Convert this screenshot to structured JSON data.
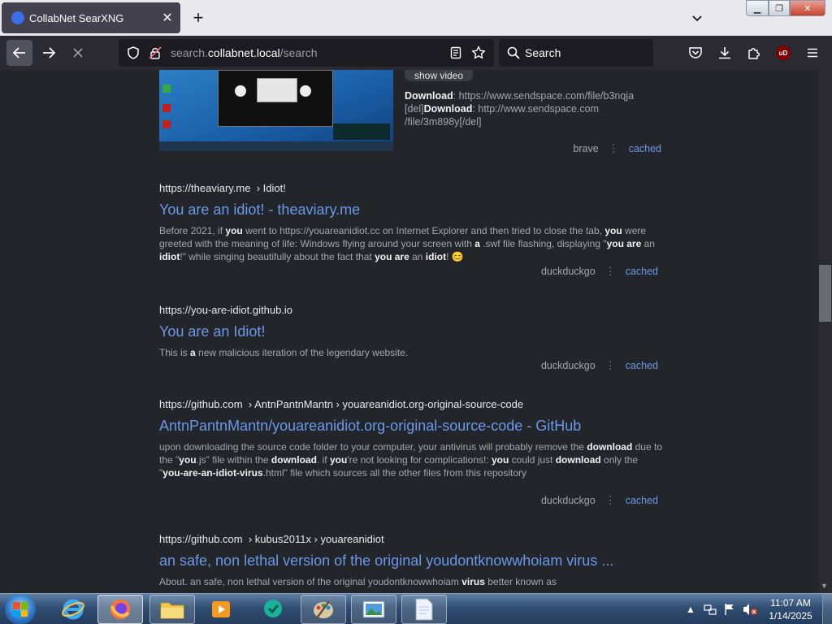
{
  "browser": {
    "tab_title": "CollabNet SearXNG",
    "url_prefix": "search.",
    "url_host": "collabnet.local",
    "url_path": "/search",
    "search_placeholder": "Search",
    "ublock_badge": "uD"
  },
  "top_result": {
    "show_video_label": "show video",
    "download_line1_label": "Download",
    "download_line1_url": ": https://www.sendspace.com/file/b3nqja",
    "download_line2_prefix": "[del]",
    "download_line2_label": "Download",
    "download_line2_url": ": http://www.sendspace.com",
    "download_line3": "/file/3m898y[/del]",
    "engine": "brave",
    "cached": "cached"
  },
  "results": [
    {
      "url_host": "https://theaviary.me",
      "url_crumbs": "› Idiot!",
      "title": "You are an idiot! - theaviary.me",
      "snippet": [
        {
          "t": "Before 2021, if ",
          "b": false
        },
        {
          "t": "you",
          "b": true
        },
        {
          "t": " went to https://youareanidiot.cc on Internet Explorer and then tried to close the tab, ",
          "b": false
        },
        {
          "t": "you",
          "b": true
        },
        {
          "t": " were greeted with the meaning of life: Windows flying around your screen with ",
          "b": false
        },
        {
          "t": "a",
          "b": true
        },
        {
          "t": " .swf file flashing, displaying \"",
          "b": false
        },
        {
          "t": "you are",
          "b": true
        },
        {
          "t": " an ",
          "b": false
        },
        {
          "t": "idiot",
          "b": true
        },
        {
          "t": "!\" while singing beautifully about the fact that ",
          "b": false
        },
        {
          "t": "you are",
          "b": true
        },
        {
          "t": " an ",
          "b": false
        },
        {
          "t": "idiot",
          "b": true
        },
        {
          "t": "! 😊",
          "b": false
        }
      ],
      "engine": "duckduckgo",
      "cached": "cached"
    },
    {
      "url_host": "https://you-are-idiot.github.io",
      "url_crumbs": "",
      "title": "You are an Idiot!",
      "snippet": [
        {
          "t": "This is ",
          "b": false
        },
        {
          "t": "a",
          "b": true
        },
        {
          "t": " new malicious iteration of the legendary website.",
          "b": false
        }
      ],
      "engine": "duckduckgo",
      "cached": "cached"
    },
    {
      "url_host": "https://github.com",
      "url_crumbs": "› AntnPantnMantn › youareanidiot.org-original-source-code",
      "title": "AntnPantnMantn/youareanidiot.org-original-source-code - GitHub",
      "snippet": [
        {
          "t": "upon downloading the source code folder to your computer, your antivirus will probably remove the ",
          "b": false
        },
        {
          "t": "download",
          "b": true
        },
        {
          "t": " due to the \"",
          "b": false
        },
        {
          "t": "you",
          "b": true
        },
        {
          "t": ".js\" file within the ",
          "b": false
        },
        {
          "t": "download",
          "b": true
        },
        {
          "t": ". if ",
          "b": false
        },
        {
          "t": "you",
          "b": true
        },
        {
          "t": "'re not looking for complications!: ",
          "b": false
        },
        {
          "t": "you",
          "b": true
        },
        {
          "t": " could just ",
          "b": false
        },
        {
          "t": "download",
          "b": true
        },
        {
          "t": " only the \"",
          "b": false
        },
        {
          "t": "you-are-an-idiot-virus",
          "b": true
        },
        {
          "t": ".html\" file which sources all the other files from this repository",
          "b": false
        }
      ],
      "engine": "duckduckgo",
      "cached": "cached"
    },
    {
      "url_host": "https://github.com",
      "url_crumbs": "› kubus2011x › youareanidiot",
      "title": "an safe, non lethal version of the original youdontknowwhoiam virus ...",
      "snippet": [
        {
          "t": "About. an safe, non lethal version of the original youdontknowwhoiam ",
          "b": false
        },
        {
          "t": "virus",
          "b": true
        },
        {
          "t": " better known as",
          "b": false
        }
      ],
      "engine": "",
      "cached": ""
    }
  ],
  "taskbar": {
    "time": "11:07 AM",
    "date": "1/14/2025"
  }
}
